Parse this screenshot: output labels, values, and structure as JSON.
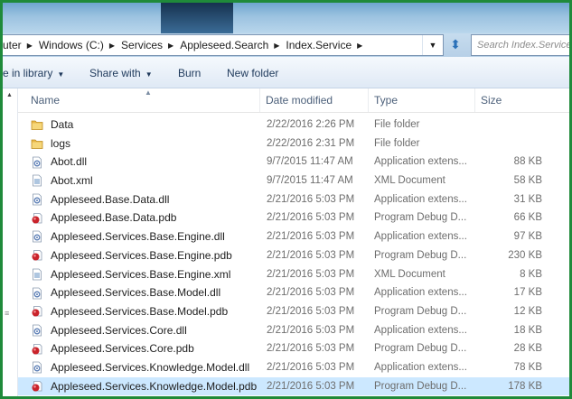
{
  "address": {
    "crumbs": [
      "uter",
      "Windows (C:)",
      "Services",
      "Appleseed.Search",
      "Index.Service"
    ]
  },
  "search": {
    "placeholder": "Search Index.Service"
  },
  "toolbar": {
    "include_label": "e in library",
    "share_label": "Share with",
    "burn_label": "Burn",
    "new_folder_label": "New folder"
  },
  "columns": {
    "name": "Name",
    "date": "Date modified",
    "type": "Type",
    "size": "Size"
  },
  "files": [
    {
      "name": "Data",
      "date": "2/22/2016 2:26 PM",
      "type": "File folder",
      "size": "",
      "icon": "folder-icon"
    },
    {
      "name": "logs",
      "date": "2/22/2016 2:31 PM",
      "type": "File folder",
      "size": "",
      "icon": "folder-icon"
    },
    {
      "name": "Abot.dll",
      "date": "9/7/2015 11:47 AM",
      "type": "Application extens...",
      "size": "88 KB",
      "icon": "dll-icon"
    },
    {
      "name": "Abot.xml",
      "date": "9/7/2015 11:47 AM",
      "type": "XML Document",
      "size": "58 KB",
      "icon": "xml-icon"
    },
    {
      "name": "Appleseed.Base.Data.dll",
      "date": "2/21/2016 5:03 PM",
      "type": "Application extens...",
      "size": "31 KB",
      "icon": "dll-icon"
    },
    {
      "name": "Appleseed.Base.Data.pdb",
      "date": "2/21/2016 5:03 PM",
      "type": "Program Debug D...",
      "size": "66 KB",
      "icon": "pdb-icon"
    },
    {
      "name": "Appleseed.Services.Base.Engine.dll",
      "date": "2/21/2016 5:03 PM",
      "type": "Application extens...",
      "size": "97 KB",
      "icon": "dll-icon"
    },
    {
      "name": "Appleseed.Services.Base.Engine.pdb",
      "date": "2/21/2016 5:03 PM",
      "type": "Program Debug D...",
      "size": "230 KB",
      "icon": "pdb-icon"
    },
    {
      "name": "Appleseed.Services.Base.Engine.xml",
      "date": "2/21/2016 5:03 PM",
      "type": "XML Document",
      "size": "8 KB",
      "icon": "xml-icon"
    },
    {
      "name": "Appleseed.Services.Base.Model.dll",
      "date": "2/21/2016 5:03 PM",
      "type": "Application extens...",
      "size": "17 KB",
      "icon": "dll-icon"
    },
    {
      "name": "Appleseed.Services.Base.Model.pdb",
      "date": "2/21/2016 5:03 PM",
      "type": "Program Debug D...",
      "size": "12 KB",
      "icon": "pdb-icon"
    },
    {
      "name": "Appleseed.Services.Core.dll",
      "date": "2/21/2016 5:03 PM",
      "type": "Application extens...",
      "size": "18 KB",
      "icon": "dll-icon"
    },
    {
      "name": "Appleseed.Services.Core.pdb",
      "date": "2/21/2016 5:03 PM",
      "type": "Program Debug D...",
      "size": "28 KB",
      "icon": "pdb-icon"
    },
    {
      "name": "Appleseed.Services.Knowledge.Model.dll",
      "date": "2/21/2016 5:03 PM",
      "type": "Application extens...",
      "size": "78 KB",
      "icon": "dll-icon"
    },
    {
      "name": "Appleseed.Services.Knowledge.Model.pdb",
      "date": "2/21/2016 5:03 PM",
      "type": "Program Debug D...",
      "size": "178 KB",
      "icon": "pdb-icon"
    }
  ]
}
